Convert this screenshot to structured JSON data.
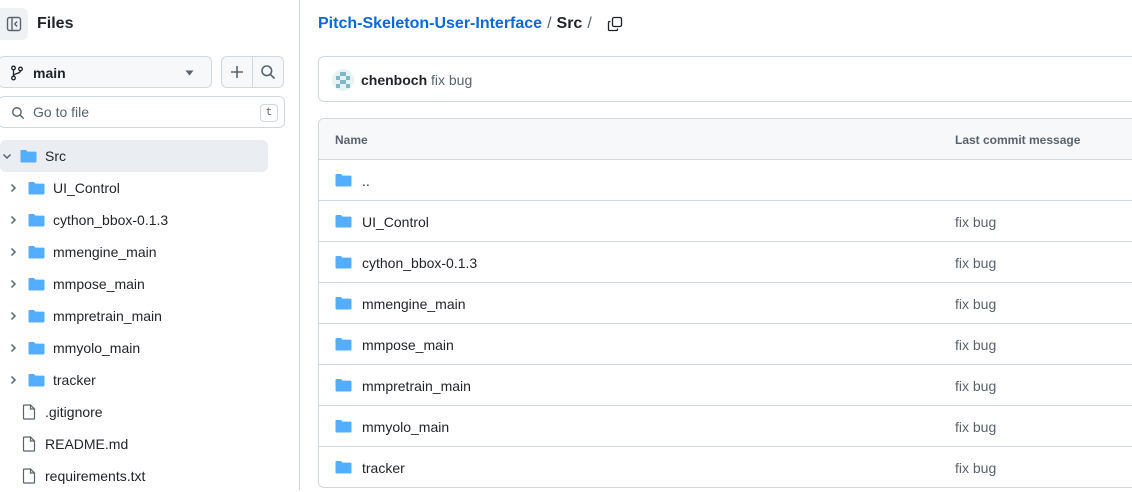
{
  "sidebar": {
    "title": "Files",
    "branch": "main",
    "search": {
      "placeholder": "Go to file",
      "shortcut": "t"
    },
    "tree": [
      {
        "label": "Src",
        "type": "folder",
        "expanded": true,
        "active": true
      },
      {
        "label": "UI_Control",
        "type": "folder"
      },
      {
        "label": "cython_bbox-0.1.3",
        "type": "folder"
      },
      {
        "label": "mmengine_main",
        "type": "folder"
      },
      {
        "label": "mmpose_main",
        "type": "folder"
      },
      {
        "label": "mmpretrain_main",
        "type": "folder"
      },
      {
        "label": "mmyolo_main",
        "type": "folder"
      },
      {
        "label": "tracker",
        "type": "folder"
      },
      {
        "label": ".gitignore",
        "type": "file"
      },
      {
        "label": "README.md",
        "type": "file"
      },
      {
        "label": "requirements.txt",
        "type": "file"
      }
    ]
  },
  "breadcrumb": {
    "repo": "Pitch-Skeleton-User-Interface",
    "separator": "/",
    "current": "Src"
  },
  "commit": {
    "author": "chenboch",
    "message": "fix bug"
  },
  "table": {
    "headers": {
      "name": "Name",
      "message": "Last commit message"
    },
    "rows": [
      {
        "name": "..",
        "message": ""
      },
      {
        "name": "UI_Control",
        "message": "fix bug"
      },
      {
        "name": "cython_bbox-0.1.3",
        "message": "fix bug"
      },
      {
        "name": "mmengine_main",
        "message": "fix bug"
      },
      {
        "name": "mmpose_main",
        "message": "fix bug"
      },
      {
        "name": "mmpretrain_main",
        "message": "fix bug"
      },
      {
        "name": "mmyolo_main",
        "message": "fix bug"
      },
      {
        "name": "tracker",
        "message": "fix bug"
      }
    ]
  },
  "icons": {
    "sidebar_toggle": "sidebar-collapse-icon",
    "branch": "git-branch-icon",
    "caret": "triangle-down-icon",
    "add": "plus-icon",
    "search": "search-icon",
    "chevron": "chevron-icon",
    "folder": "folder-icon",
    "file": "file-icon",
    "copy": "copy-icon"
  },
  "colors": {
    "link": "#0969da",
    "folder": "#54aeff",
    "muted": "#59636e",
    "border": "#d1d9e0",
    "active_row": "#eaeef2"
  }
}
